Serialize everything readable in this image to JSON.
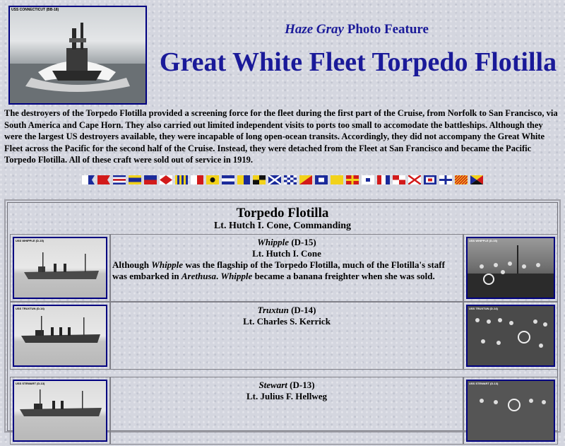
{
  "header": {
    "photo_caption": "USS CONNECTICUT (BB-18)",
    "kicker_italic": "Haze Gray",
    "kicker_rest": " Photo Feature",
    "title": "Great White Fleet Torpedo Flotilla"
  },
  "intro": "The destroyers of the Torpedo Flotilla provided a screening force for the fleet during the first part of the Cruise, from Norfolk to San Francisco, via South America and Cape Horn. They also carried out limited independent visits to ports too small to accomodate the battleships. Although they were the largest US destroyers available, they were incapable of long open-ocean transits. Accordingly, they did not accompany the Great White Fleet across the Pacific for the second half of the Cruise. Instead, they were detached from the Fleet at San Francisco and became the Pacific Torpedo Flotilla. All of these craft were sold out of service in 1919.",
  "flags": [
    "A",
    "B",
    "C",
    "D",
    "E",
    "F",
    "G",
    "H",
    "I",
    "J",
    "K",
    "L",
    "M",
    "N",
    "O",
    "P",
    "Q",
    "R",
    "S",
    "T",
    "U",
    "V",
    "W",
    "X",
    "Y",
    "Z"
  ],
  "roster": {
    "title": "Torpedo Flotilla",
    "subtitle": "Lt. Hutch I. Cone, Commanding",
    "ships": [
      {
        "name": "Whipple",
        "hull": " (D-15)",
        "commander": "Lt. Hutch I. Cone",
        "left_caption": "USS WHIPPLE (D-15)",
        "right_caption": "USS WHIPPLE (D-15)",
        "note_1": "Although ",
        "note_2": "Whipple",
        "note_3": " was the flagship of the Torpedo Flotilla, much of the Flotilla's staff was embarked in ",
        "note_4": "Arethusa",
        "note_5": ". ",
        "note_6": "Whipple",
        "note_7": " became a banana freighter when she was sold."
      },
      {
        "name": "Truxtun",
        "hull": " (D-14)",
        "commander": "Lt. Charles S. Kerrick",
        "left_caption": "USS TRUXTUN (D-14)",
        "right_caption": "USS TRUXTUN (D-14)"
      },
      {
        "name": "Stewart",
        "hull": " (D-13)",
        "commander": "Lt. Julius F. Hellweg",
        "left_caption": "USS STEWART (D-13)",
        "right_caption": "USS STEWART (D-13)"
      }
    ]
  },
  "colors": {
    "title_blue": "#1a1a99",
    "frame_blue": "#000080"
  }
}
